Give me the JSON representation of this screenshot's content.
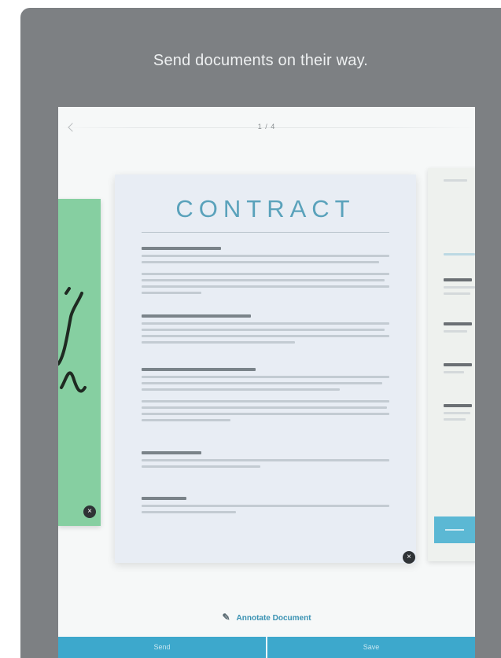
{
  "headline": "Send documents on their way.",
  "topbar": {
    "page_indicator": "1 / 4"
  },
  "document": {
    "title": "CONTRACT"
  },
  "actions": {
    "edit_label": "Annotate Document"
  },
  "bottom_bar": {
    "left_label": "Send",
    "right_label": "Save"
  },
  "icons": {
    "back": "chevron-left-icon",
    "edit": "pencil-icon",
    "badge": "close-icon"
  },
  "colors": {
    "accent": "#3da8cc",
    "title": "#5aa2bb",
    "green_card": "#86cfa1",
    "frame": "#7d8083"
  }
}
